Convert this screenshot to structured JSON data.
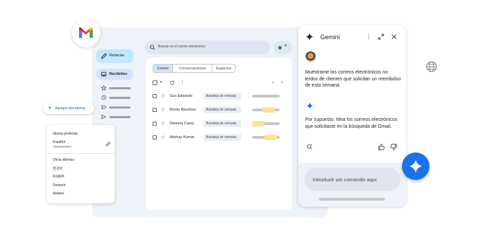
{
  "colors": {
    "accent_blue": "#0b57d0",
    "compose_bg": "#c2e7ff",
    "inbox_bg": "#d3e3fd",
    "window_bg": "#eef2f9",
    "gemini_fab": "#1a73e8",
    "highlight_yellow": "#fde293"
  },
  "search": {
    "placeholder": "Buscar en el correo electrónico"
  },
  "sidebar": {
    "compose_label": "Redactar",
    "inbox_label": "Recibidos",
    "items": [
      {
        "icon": "star-icon"
      },
      {
        "icon": "clock-icon"
      },
      {
        "icon": "important-icon"
      },
      {
        "icon": "send-icon"
      }
    ]
  },
  "tabs": [
    {
      "label": "Correo",
      "active": true
    },
    {
      "label": "Conversaciones",
      "active": false
    },
    {
      "label": "Espacios",
      "active": false
    }
  ],
  "emails": [
    {
      "sender": "Gus Edwards",
      "label": "Bandeja de entrada",
      "highlighted": false
    },
    {
      "sender": "Becky Barshow",
      "label": "Bandeja de entrada",
      "highlighted": true
    },
    {
      "sender": "Deanna Carey",
      "label": "Bandeja de entrada",
      "highlighted": true
    },
    {
      "sender": "Akshay Kumar",
      "label": "Bandeja de entrada",
      "highlighted": true
    }
  ],
  "language": {
    "add_label": "Agregar otro idioma",
    "preferred_title": "Idioma preferido",
    "preferred_value": "Español",
    "other_title": "Otros idiomas",
    "options": [
      "한국어",
      "English",
      "Deutsch",
      "Italiano"
    ]
  },
  "gemini": {
    "title": "Gemini",
    "user_message": "Muéstrame los correos electrónicos no leídos de clientes que solicitan un reembolso de esta semana",
    "reply": "Por supuesto. Mira los correos electrónicos que solicitaste en la búsqueda de Gmail.",
    "input_placeholder": "Introduzir um comando aqui"
  }
}
